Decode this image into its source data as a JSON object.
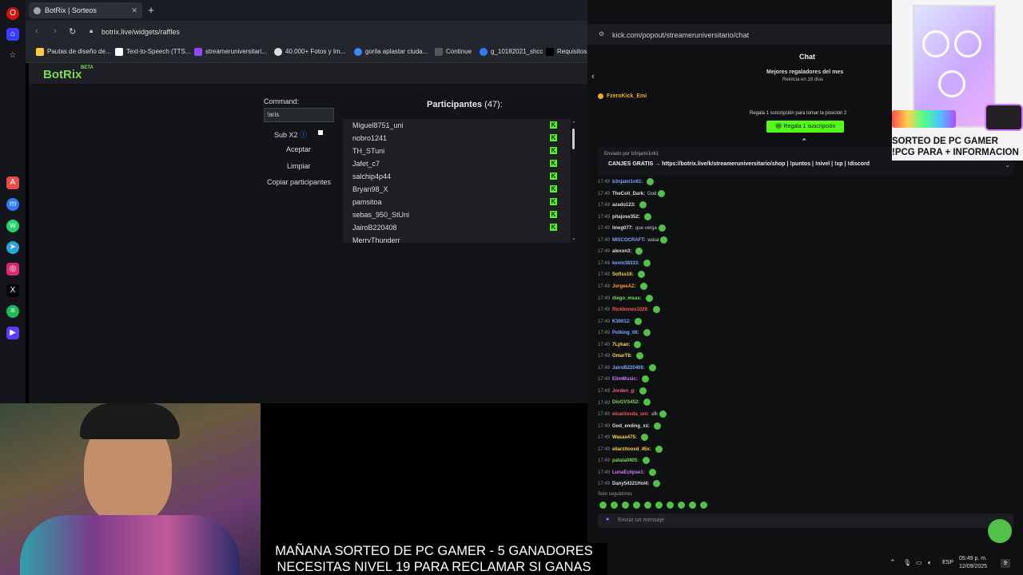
{
  "browser": {
    "tab_title": "BotRix | Sorteos",
    "url": "botrix.live/widgets/raffles",
    "bookmarks": [
      "Pautas de diseño de...",
      "Text-to-Speech (TTS...",
      "streameruniversitari...",
      "40.000+ Fotos y Im...",
      "gorila aplastar ciuda...",
      "Continue",
      "g_10182021_shcc",
      "Requisitos"
    ]
  },
  "botrix": {
    "logo": "BotRix",
    "beta": "BETA",
    "command_label": "Command:",
    "command_value": "!aris",
    "sub_label": "Sub X2",
    "accept_label": "Aceptar",
    "clear_label": "Limpiar",
    "copy_label": "Copiar participantes",
    "participants_title": "Participantes",
    "participants_count": "(47):",
    "participants": [
      "Miguel8751_uni",
      "nobro1241",
      "TH_STuni",
      "Jafet_c7",
      "salchip4p44",
      "Bryan98_X",
      "pamsitoa",
      "sebas_950_StUni",
      "JairoB220408",
      "MerryThunderr"
    ]
  },
  "kick": {
    "url": "kick.com/popout/streameruniversitario/chat",
    "chat_title": "Chat",
    "gifters_title": "Mejores regaladores del mes",
    "gifters_sub": "Reinicia en 18 días",
    "top_gifter": "FzeroKick_Emi",
    "gift_msg": "Regala 1 suscripción para tomar la posición 2",
    "gift_button": "Regala 1 suscripción",
    "pinned_head": "Enviado por b3njami1n61",
    "pinned_text": "CANJES GRATIS → https://botrix.live/k/streameruniversitario/shop | !puntos | !nivel | !xp | !discord",
    "messages": [
      {
        "time": "17:49",
        "user": "b3njami1n61:",
        "text": "",
        "color": "#7aa7ff"
      },
      {
        "time": "17:49",
        "user": "TheColt_Dark:",
        "text": "God",
        "color": "#ddd"
      },
      {
        "time": "17:49",
        "user": "azado123:",
        "text": "",
        "color": "#ddd"
      },
      {
        "time": "17:49",
        "user": "pitajose352:",
        "text": "",
        "color": "#ddd"
      },
      {
        "time": "17:49",
        "user": "lmeg077:",
        "text": "que verga",
        "color": "#ddd"
      },
      {
        "time": "17:49",
        "user": "MISCOCRAFT:",
        "text": "wasa",
        "color": "#7aa7ff"
      },
      {
        "time": "17:49",
        "user": "alexon3:",
        "text": "",
        "color": "#ddd"
      },
      {
        "time": "17:49",
        "user": "kevin38333:",
        "text": "",
        "color": "#7aa7ff"
      },
      {
        "time": "17:49",
        "user": "Sofiss16:",
        "text": "",
        "color": "#ffd24d"
      },
      {
        "time": "17:49",
        "user": "JorgeeAZ:",
        "text": "",
        "color": "#ff9a3c"
      },
      {
        "time": "17:49",
        "user": "diego_msas:",
        "text": "",
        "color": "#7ed957"
      },
      {
        "time": "17:49",
        "user": "Rickbones1029:",
        "text": "",
        "color": "#ff5a5a"
      },
      {
        "time": "17:49",
        "user": "K30012:",
        "text": "",
        "color": "#7aa7ff"
      },
      {
        "time": "17:49",
        "user": "Polking_06:",
        "text": "",
        "color": "#7aa7ff"
      },
      {
        "time": "17:49",
        "user": "7Lykan:",
        "text": "",
        "color": "#ffd24d"
      },
      {
        "time": "17:49",
        "user": "OmarT8:",
        "text": "",
        "color": "#ffd24d"
      },
      {
        "time": "17:49",
        "user": "JairoB220408:",
        "text": "",
        "color": "#7aa7ff"
      },
      {
        "time": "17:49",
        "user": "ElimMusic:",
        "text": "",
        "color": "#d07aff"
      },
      {
        "time": "17:49",
        "user": "Jorden_g:",
        "text": "",
        "color": "#ff5a8a"
      },
      {
        "time": "17:49",
        "user": "DioGVS452:",
        "text": "",
        "color": "#7ed957"
      },
      {
        "time": "17:49",
        "user": "elcaritosda_uni:",
        "text": "afk",
        "color": "#ff5a5a"
      },
      {
        "time": "17:49",
        "user": "God_ending_xx:",
        "text": "",
        "color": "#ddd"
      },
      {
        "time": "17:49",
        "user": "Wasas475:",
        "text": "",
        "color": "#ffd24d"
      },
      {
        "time": "17:49",
        "user": "eliarzitooxd_45x:",
        "text": "",
        "color": "#ffd24d"
      },
      {
        "time": "17:49",
        "user": "patata0405:",
        "text": "",
        "color": "#7ed957"
      },
      {
        "time": "17:49",
        "user": "LunaEclipse1:",
        "text": "",
        "color": "#d07aff"
      },
      {
        "time": "17:49",
        "user": "Dany54321Hol4:",
        "text": "",
        "color": "#ddd"
      }
    ],
    "followers_only": "Solo seguidores",
    "input_placeholder": "Enviar un mensaje"
  },
  "overlay": {
    "line1": "SORTEO DE PC GAMER",
    "line2": "!PCG PARA + INFORMACION"
  },
  "caption": {
    "line1": "MAÑANA SORTEO DE PC GAMER - 5 GANADORES",
    "line2": "NECESITAS NIVEL 19 PARA RECLAMAR SI GANAS"
  },
  "taskbar": {
    "lang": "ESP",
    "time": "05:49 p. m.",
    "date": "12/09/2025",
    "notifications": "9"
  },
  "colors": {
    "kick_green": "#53fc18",
    "botrix_green": "#7ed957"
  }
}
